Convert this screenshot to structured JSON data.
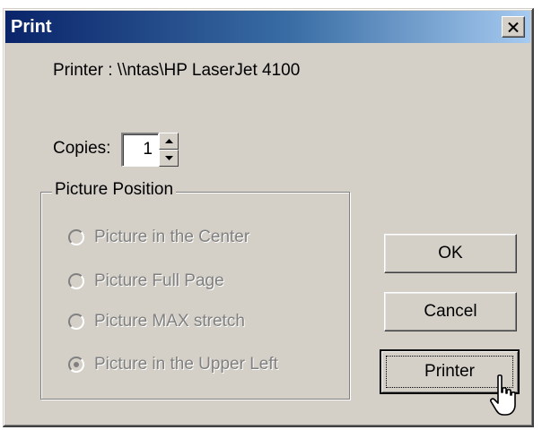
{
  "dialog": {
    "title": "Print",
    "printer_line": "Printer : \\\\ntas\\HP LaserJet 4100",
    "copies_label": "Copies:",
    "copies_value": "1"
  },
  "picture_position": {
    "legend": "Picture Position",
    "options": [
      {
        "label": "Picture in the Center",
        "checked": false,
        "enabled": false
      },
      {
        "label": "Picture Full Page",
        "checked": false,
        "enabled": false
      },
      {
        "label": "Picture MAX stretch",
        "checked": false,
        "enabled": false
      },
      {
        "label": "Picture in the Upper Left",
        "checked": true,
        "enabled": false
      }
    ]
  },
  "buttons": {
    "ok": "OK",
    "cancel": "Cancel",
    "printer": "Printer"
  },
  "icons": {
    "close": "close-icon",
    "spin_up": "arrow-up-icon",
    "spin_down": "arrow-down-icon",
    "cursor": "hand-pointer-cursor-icon"
  },
  "colors": {
    "titlebar_start": "#0a246a",
    "titlebar_end": "#a6caf0",
    "face": "#d4d0c8",
    "disabled_text": "#808080"
  }
}
